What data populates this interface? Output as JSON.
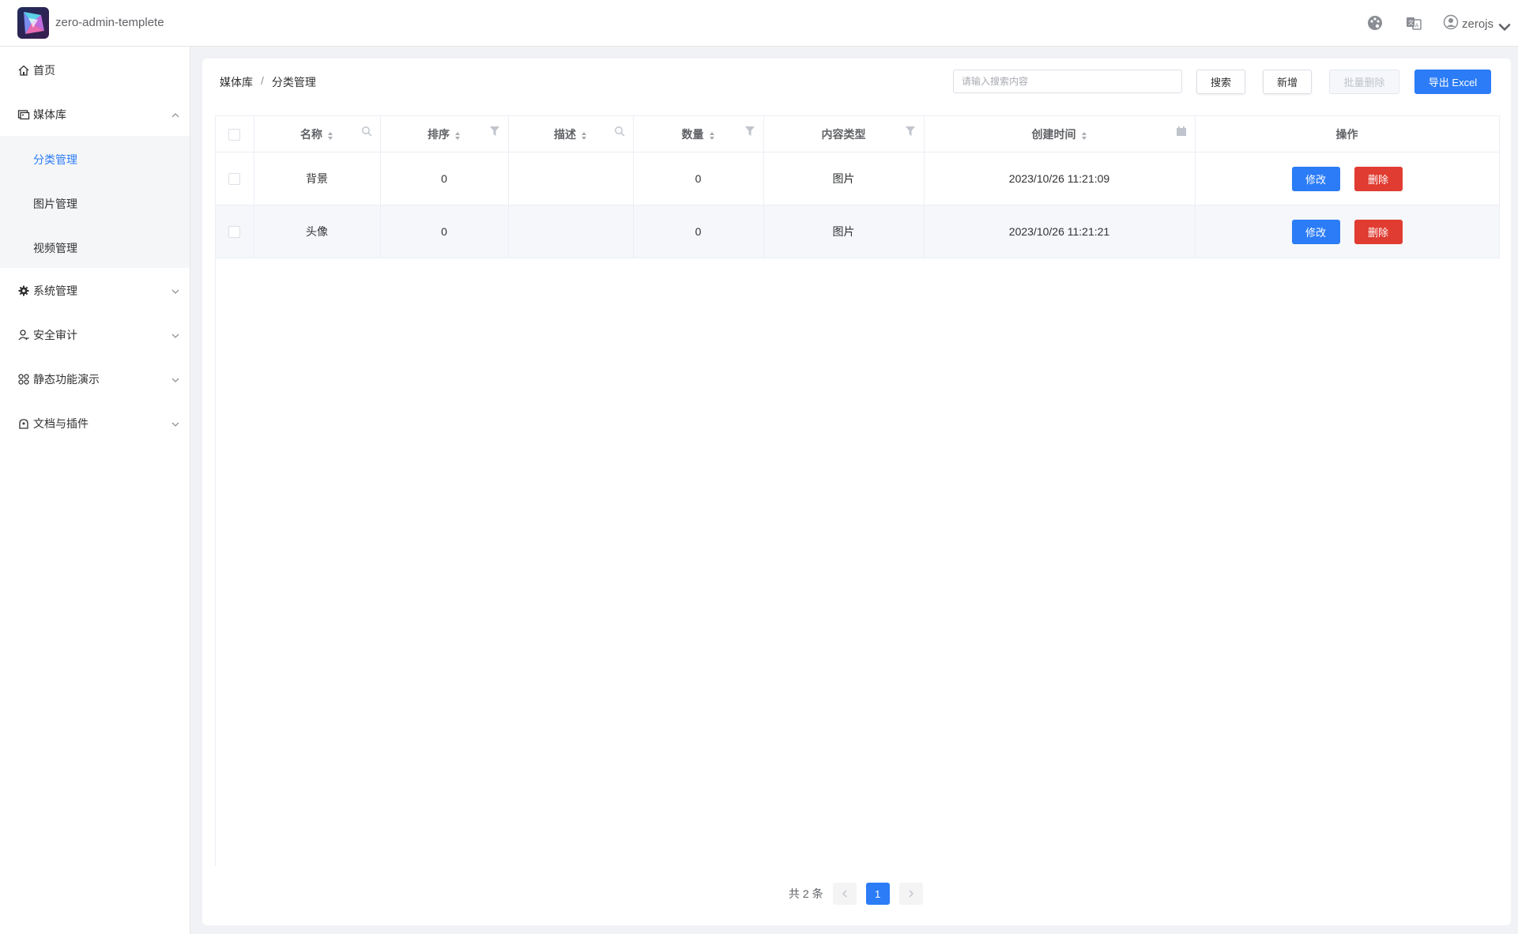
{
  "header": {
    "app_title": "zero-admin-templete",
    "username": "zerojs"
  },
  "sidebar": {
    "items": [
      {
        "label": "首页",
        "icon": "home-icon"
      },
      {
        "label": "媒体库",
        "icon": "media-icon",
        "expanded": true,
        "children": [
          {
            "label": "分类管理",
            "active": true
          },
          {
            "label": "图片管理"
          },
          {
            "label": "视频管理"
          }
        ]
      },
      {
        "label": "系统管理",
        "icon": "gear-icon"
      },
      {
        "label": "安全审计",
        "icon": "user-icon"
      },
      {
        "label": "静态功能演示",
        "icon": "grid-icon"
      },
      {
        "label": "文档与插件",
        "icon": "plugin-icon"
      }
    ]
  },
  "breadcrumb": [
    "媒体库",
    "/",
    "分类管理"
  ],
  "toolbar": {
    "search_placeholder": "请输入搜索内容",
    "search_label": "搜索",
    "add_label": "新增",
    "batch_delete_label": "批量删除",
    "export_label": "导出 Excel"
  },
  "table": {
    "columns": [
      "名称",
      "排序",
      "描述",
      "数量",
      "内容类型",
      "创建时间",
      "操作"
    ],
    "rows": [
      {
        "name": "背景",
        "sort": "0",
        "desc": "",
        "count": "0",
        "type": "图片",
        "created": "2023/10/26 11:21:09"
      },
      {
        "name": "头像",
        "sort": "0",
        "desc": "",
        "count": "0",
        "type": "图片",
        "created": "2023/10/26 11:21:21"
      }
    ],
    "edit_label": "修改",
    "delete_label": "删除"
  },
  "pagination": {
    "total_text": "共 2 条",
    "current_page": "1"
  },
  "colors": {
    "primary": "#2b7cf6",
    "danger": "#e03c32"
  }
}
